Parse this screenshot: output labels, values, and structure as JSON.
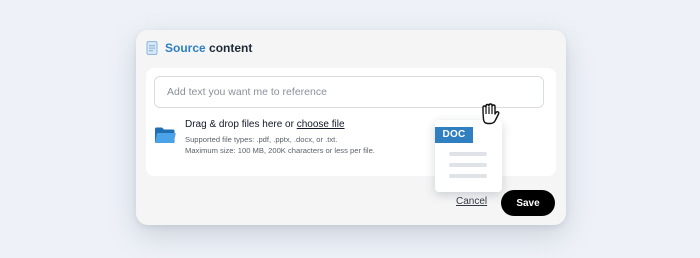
{
  "dialog": {
    "title_accent": "Source",
    "title_rest": " content",
    "icon": "document-icon"
  },
  "text_input": {
    "placeholder": "Add text you want me to reference",
    "value": ""
  },
  "dropzone": {
    "icon": "folder-icon",
    "main_text": "Drag & drop files here or ",
    "link_text": "choose file",
    "supported_types": "Supported file types: .pdf, .pptx, .docx, or .txt.",
    "max_size": "Maximum size: 100 MB, 200K characters or less per file."
  },
  "actions": {
    "cancel_label": "Cancel",
    "save_label": "Save"
  },
  "dragged_file": {
    "badge": "DOC",
    "cursor_icon": "grab-hand-icon"
  },
  "colors": {
    "accent": "#2f80c1",
    "save_bg": "#000000",
    "page_bg": "#eef2f8"
  }
}
